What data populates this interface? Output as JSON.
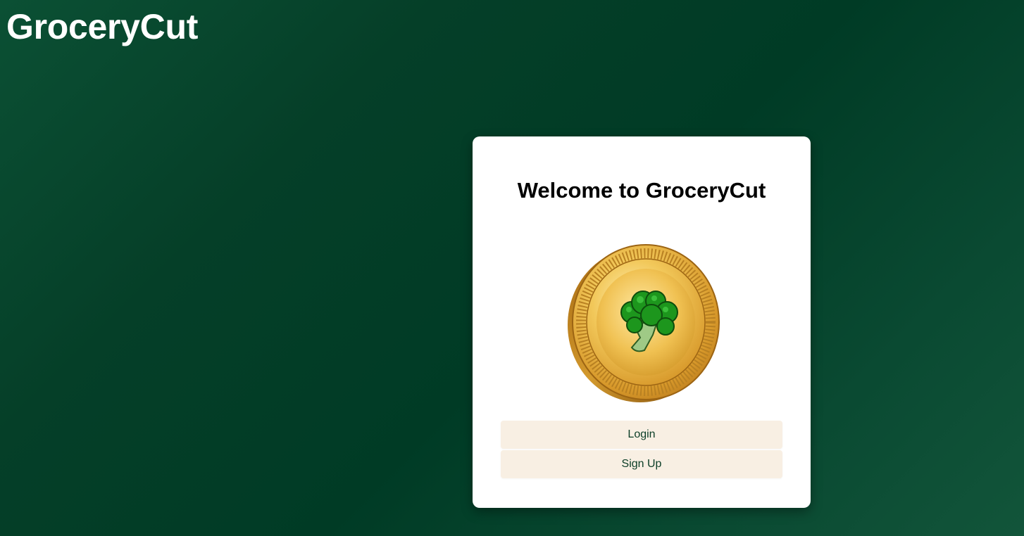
{
  "header": {
    "brand": "GroceryCut"
  },
  "card": {
    "title": "Welcome to GroceryCut",
    "logo_icon": "gold-coin-broccoli-icon",
    "login_label": "Login",
    "signup_label": "Sign Up"
  },
  "colors": {
    "background": "#053f28",
    "card": "#ffffff",
    "button_bg": "#f8efe3",
    "button_text": "#0b3d26",
    "gold": "#e7b43f",
    "broccoli": "#1f8f1f"
  }
}
